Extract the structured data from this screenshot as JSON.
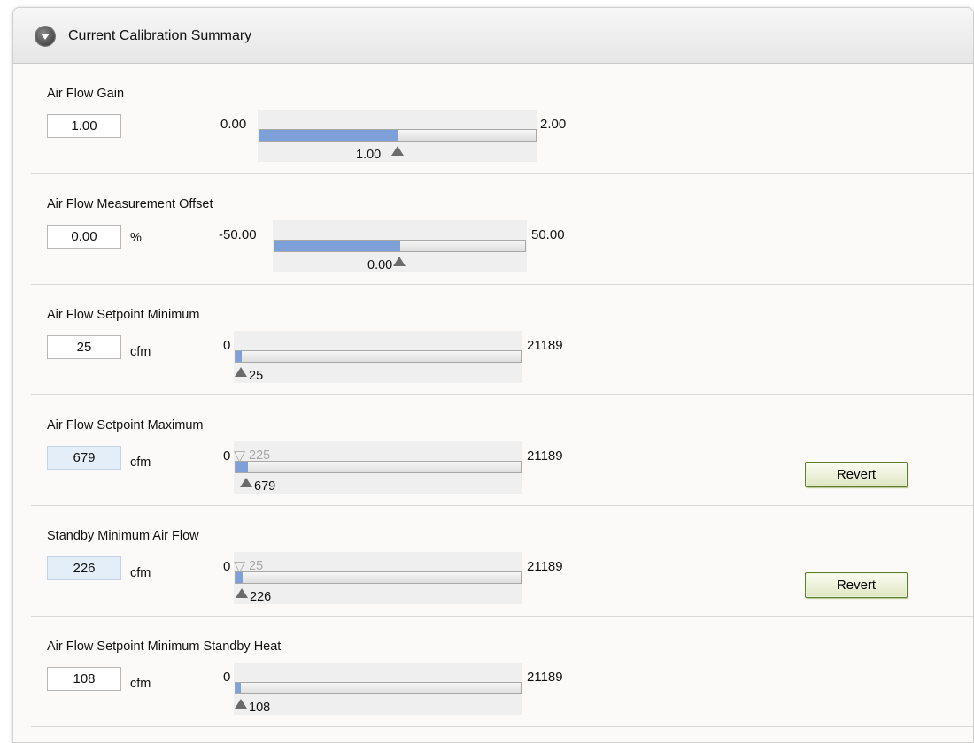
{
  "panel": {
    "title": "Current Calibration Summary"
  },
  "fields": [
    {
      "label": "Air Flow Gain",
      "value": "1.00",
      "unit": "",
      "min": "0.00",
      "max": "2.00",
      "marker_value": "1.00",
      "fill_fraction": 0.5
    },
    {
      "label": "Air Flow Measurement Offset",
      "value": "0.00",
      "unit": "%",
      "min": "-50.00",
      "max": "50.00",
      "marker_value": "0.00",
      "fill_fraction": 0.5
    },
    {
      "label": "Air Flow Setpoint Minimum",
      "value": "25",
      "unit": "cfm",
      "min": "0",
      "max": "21189",
      "marker_value": "25",
      "fill_fraction": 0.0012
    },
    {
      "label": "Air Flow Setpoint Maximum",
      "value": "679",
      "unit": "cfm",
      "min": "0",
      "max": "21189",
      "marker_value": "679",
      "previous_value": "225",
      "fill_fraction": 0.032,
      "revert_label": "Revert"
    },
    {
      "label": "Standby Minimum Air Flow",
      "value": "226",
      "unit": "cfm",
      "min": "0",
      "max": "21189",
      "marker_value": "226",
      "previous_value": "25",
      "fill_fraction": 0.0107,
      "revert_label": "Revert"
    },
    {
      "label": "Air Flow Setpoint Minimum Standby Heat",
      "value": "108",
      "unit": "cfm",
      "min": "0",
      "max": "21189",
      "marker_value": "108",
      "fill_fraction": 0.0051
    }
  ],
  "colors": {
    "fill": "#7ea0d8",
    "changed_value_bg": "#e4eef8",
    "revert_border": "#5c7e2e"
  }
}
